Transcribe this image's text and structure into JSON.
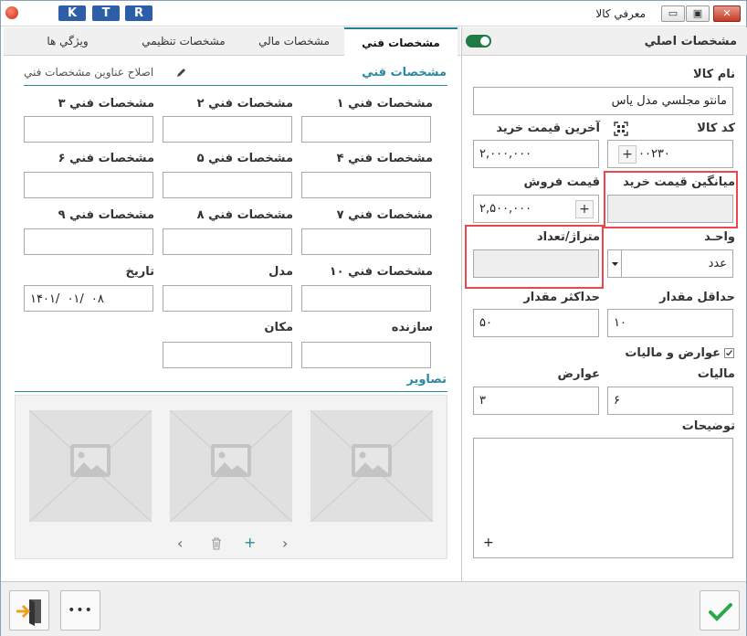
{
  "window": {
    "title": "معرفي كالا",
    "ktr": [
      "K",
      "T",
      "R"
    ],
    "min": "▭",
    "max": "▣",
    "close": "✕"
  },
  "right_panel": {
    "header": "مشخصات اصلي",
    "name_label": "نام كالا",
    "name_value": "مانتو مجلسي مدل ياس",
    "code_label": "كد كالا",
    "code_value": "۱۰۰۲۳۰",
    "last_price_label": "آخرين قيمت خريد",
    "last_price_value": "۲,۰۰۰,۰۰۰",
    "avg_price_label": "ميانگين قيمت خريد",
    "avg_price_value": "",
    "sale_price_label": "قيمت فروش",
    "sale_price_value": "۲,۵۰۰,۰۰۰",
    "unit_label": "واحـد",
    "unit_value": "عدد",
    "meter_label": "متراژ/تعداد",
    "meter_value": "",
    "min_qty_label": "حداقل مقدار",
    "min_qty_value": "۱۰",
    "max_qty_label": "حداكثر مقدار",
    "max_qty_value": "۵۰",
    "duties_checkbox_label": "عوارض و ماليات",
    "tax_label": "ماليات",
    "tax_value": "۶",
    "duty_label": "عوارض",
    "duty_value": "۳",
    "desc_label": "توضيحات",
    "plus": "+"
  },
  "tabs": [
    "مشخصات فني",
    "مشخصات مالي",
    "مشخصات تنظيمي",
    "ويژگي ها"
  ],
  "left_panel": {
    "section_title": "مشخصات فني",
    "edit_link": "اصلاح عناوين مشخصات فني",
    "specs": [
      {
        "label": "مشخصات فني ۱",
        "value": ""
      },
      {
        "label": "مشخصات فني ۲",
        "value": ""
      },
      {
        "label": "مشخصات فني ۳",
        "value": ""
      },
      {
        "label": "مشخصات فني ۴",
        "value": ""
      },
      {
        "label": "مشخصات فني ۵",
        "value": ""
      },
      {
        "label": "مشخصات فني ۶",
        "value": ""
      },
      {
        "label": "مشخصات فني ۷",
        "value": ""
      },
      {
        "label": "مشخصات فني ۸",
        "value": ""
      },
      {
        "label": "مشخصات فني ۹",
        "value": ""
      },
      {
        "label": "مشخصات فني ۱۰",
        "value": ""
      },
      {
        "label": "مدل",
        "value": ""
      },
      {
        "label": "تاريخ",
        "value": "۱۴۰۱/ ۰۱/ ۰۸"
      },
      {
        "label": "سازنده",
        "value": ""
      },
      {
        "label": "مكان",
        "value": ""
      }
    ],
    "images_title": "تصاوير",
    "img_nav": {
      "prev": "‹",
      "delete": "🗑",
      "add": "+",
      "next": "›"
    }
  },
  "footer": {
    "more": "•••",
    "ok": "✓"
  },
  "colors": {
    "accent": "#2a8aa0",
    "ktr": "#2d5fa8",
    "ok": "#2aa84a",
    "exit": "#f0a020",
    "highlight": "#e8474c"
  }
}
